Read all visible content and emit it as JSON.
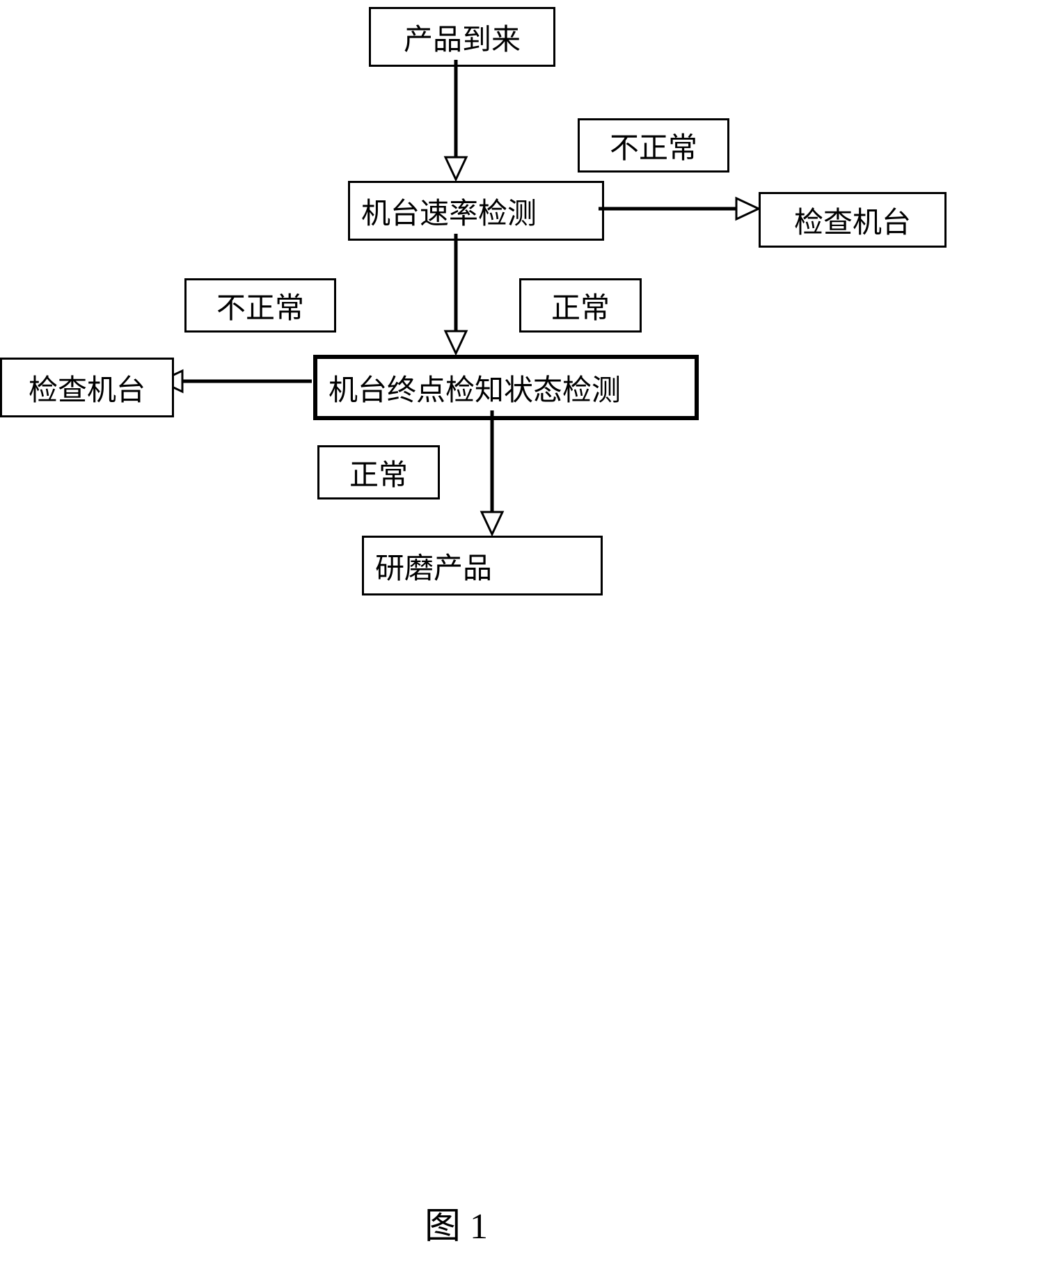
{
  "nodes": {
    "start": "产品到来",
    "speed_check": "机台速率检测",
    "endpoint_check": "机台终点检知状态检测",
    "grind": "研磨产品",
    "inspect_left": "检查机台",
    "inspect_right": "检查机台"
  },
  "labels": {
    "abnormal_top": "不正常",
    "abnormal_left": "不正常",
    "normal_mid": "正常",
    "normal_bottom": "正常"
  },
  "caption": "图 1",
  "chart_data": {
    "type": "flowchart",
    "title": "图 1",
    "nodes": [
      {
        "id": "start",
        "label": "产品到来",
        "type": "process"
      },
      {
        "id": "speed_check",
        "label": "机台速率检测",
        "type": "decision"
      },
      {
        "id": "endpoint_check",
        "label": "机台终点检知状态检测",
        "type": "decision"
      },
      {
        "id": "grind",
        "label": "研磨产品",
        "type": "process"
      },
      {
        "id": "inspect_right",
        "label": "检查机台",
        "type": "process"
      },
      {
        "id": "inspect_left",
        "label": "检查机台",
        "type": "process"
      }
    ],
    "edges": [
      {
        "from": "start",
        "to": "speed_check",
        "label": ""
      },
      {
        "from": "speed_check",
        "to": "endpoint_check",
        "label": "正常"
      },
      {
        "from": "speed_check",
        "to": "inspect_right",
        "label": "不正常"
      },
      {
        "from": "endpoint_check",
        "to": "grind",
        "label": "正常"
      },
      {
        "from": "endpoint_check",
        "to": "inspect_left",
        "label": "不正常"
      }
    ]
  }
}
